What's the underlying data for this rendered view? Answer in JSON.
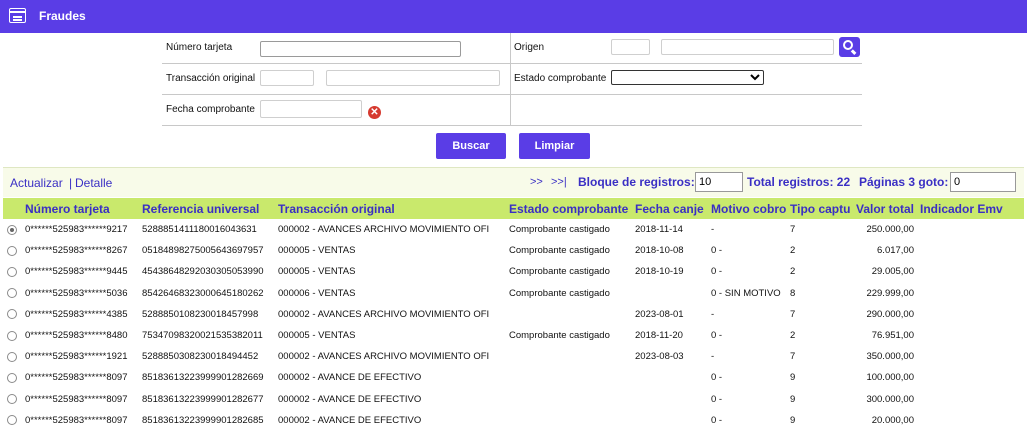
{
  "app": {
    "title": "Fraudes",
    "icon": "card-list-icon"
  },
  "form": {
    "numero_tarjeta_label": "Número tarjeta",
    "numero_tarjeta_value": "",
    "transaccion_original_label": "Transacción original",
    "transaccion_original_code": "",
    "transaccion_original_desc": "",
    "fecha_comprobante_label": "Fecha comprobante",
    "fecha_comprobante_value": "",
    "origen_label": "Origen",
    "origen_code": "",
    "origen_desc": "",
    "estado_comprobante_label": "Estado comprobante",
    "estado_comprobante_value": "",
    "clear_symbol": "✕"
  },
  "buttons": {
    "buscar": "Buscar",
    "limpiar": "Limpiar"
  },
  "toolbar": {
    "actualizar": "Actualizar",
    "separator": "|",
    "detalle": "Detalle",
    "next": ">>",
    "last": ">>|",
    "bloque_label": "Bloque de registros:",
    "bloque_value": "10",
    "total_label": "Total registros: 22",
    "paginas_label": "Páginas 3 goto:",
    "goto_value": "0"
  },
  "table": {
    "headers": [
      "Número tarjeta",
      "Referencia universal",
      "Transacción original",
      "Estado comprobante",
      "Fecha canje",
      "Motivo cobro",
      "Tipo captura",
      "Valor total",
      "Indicador Emv"
    ],
    "rows": [
      [
        "0******525983******9217",
        "528885141118001604363​1",
        "000002 - AVANCES ARCHIVO MOVIMIENTO OFI",
        "Comprobante castigado",
        "2018-11-14",
        "-",
        "7",
        "250.000,00",
        ""
      ],
      [
        "0******525983******8267",
        "05184898275005643697957",
        "000005 - VENTAS",
        "Comprobante castigado",
        "2018-10-08",
        "0 -",
        "2",
        "6.017,00",
        ""
      ],
      [
        "0******525983******9445",
        "45438648292030305053990",
        "000005 - VENTAS",
        "Comprobante castigado",
        "2018-10-19",
        "0 -",
        "2",
        "29.005,00",
        ""
      ],
      [
        "0******525983******5036",
        "85426468323000645180262",
        "000006 - VENTAS",
        "Comprobante castigado",
        "",
        "0 - SIN MOTIVO",
        "8",
        "229.999,00",
        ""
      ],
      [
        "0******525983******4385",
        "52888501082300184579​98",
        "000002 - AVANCES ARCHIVO MOVIMIENTO OFI",
        "",
        "2023-08-01",
        "-",
        "7",
        "290.000,00",
        ""
      ],
      [
        "0******525983******8480",
        "75347098320021535382011",
        "000005 - VENTAS",
        "Comprobante castigado",
        "2018-11-20",
        "0 -",
        "2",
        "76.951,00",
        ""
      ],
      [
        "0******525983******1921",
        "52888503082300184944​52",
        "000002 - AVANCES ARCHIVO MOVIMIENTO OFI",
        "",
        "2023-08-03",
        "-",
        "7",
        "350.000,00",
        ""
      ],
      [
        "0******525983******8097",
        "85183613223999901282669",
        "000002 - AVANCE DE EFECTIVO",
        "",
        "",
        "0 -",
        "9",
        "100.000,00",
        ""
      ],
      [
        "0******525983******8097",
        "85183613223999901282677",
        "000002 - AVANCE DE EFECTIVO",
        "",
        "",
        "0 -",
        "9",
        "300.000,00",
        ""
      ],
      [
        "0******525983******8097",
        "85183613223999901282685",
        "000002 - AVANCE DE EFECTIVO",
        "",
        "",
        "0 -",
        "9",
        "20.000,00",
        ""
      ]
    ],
    "selected_row": 0
  }
}
